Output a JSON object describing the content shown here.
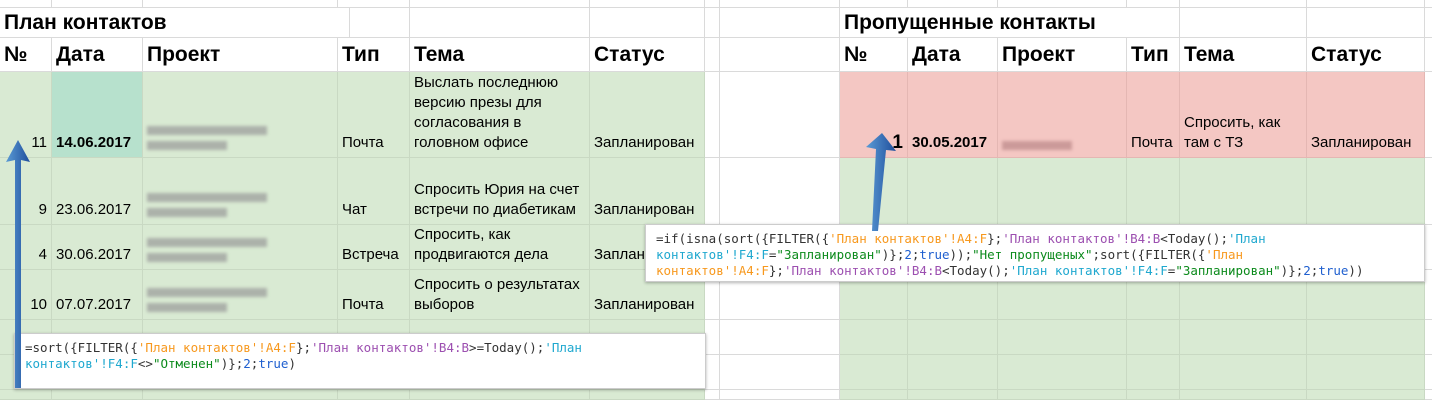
{
  "left": {
    "title": "План контактов",
    "headers": [
      "№",
      "Дата",
      "Проект",
      "Тип",
      "Тема",
      "Статус"
    ],
    "rows": [
      {
        "num": "11",
        "date": "14.06.2017",
        "type": "Почта",
        "topic": "Выслать последнюю версию презы для согласования в головном офисе",
        "status": "Запланирован"
      },
      {
        "num": "9",
        "date": "23.06.2017",
        "type": "Чат",
        "topic": "Спросить Юрия на счет встречи по диабетикам",
        "status": "Запланирован"
      },
      {
        "num": "4",
        "date": "30.06.2017",
        "type": "Встреча",
        "topic": "Спросить, как продвигаются дела",
        "status": "Заплан"
      },
      {
        "num": "10",
        "date": "07.07.2017",
        "type": "Почта",
        "topic": "Спросить о результатах выборов",
        "status": "Запланирован"
      }
    ]
  },
  "right": {
    "title": "Пропущенные контакты",
    "headers": [
      "№",
      "Дата",
      "Проект",
      "Тип",
      "Тема",
      "Статус"
    ],
    "rows": [
      {
        "num": "1",
        "date": "30.05.2017",
        "type": "Почта",
        "topic": "Спросить, как там с ТЗ",
        "status": "Запланирован"
      }
    ]
  },
  "formula_left": [
    {
      "t": "=sort({FILTER({",
      "c": "#333"
    },
    {
      "t": "'План контактов'!A4:F",
      "c": "#f7981d"
    },
    {
      "t": "};",
      "c": "#333"
    },
    {
      "t": "'План контактов'!B4:B",
      "c": "#9c4fb0"
    },
    {
      "t": ">=Today();",
      "c": "#333"
    },
    {
      "t": "'План\nконтактов'!F4:F",
      "c": "#1fa8cf"
    },
    {
      "t": "<>",
      "c": "#333"
    },
    {
      "t": "\"Отменен\"",
      "c": "#0b8a1b"
    },
    {
      "t": ")};",
      "c": "#333"
    },
    {
      "t": "2",
      "c": "#1f5fcf"
    },
    {
      "t": ";",
      "c": "#333"
    },
    {
      "t": "true",
      "c": "#1f5fcf"
    },
    {
      "t": ")",
      "c": "#333"
    }
  ],
  "formula_right": [
    {
      "t": "=if(isna(sort({FILTER({",
      "c": "#333"
    },
    {
      "t": "'План контактов'!A4:F",
      "c": "#f7981d"
    },
    {
      "t": "};",
      "c": "#333"
    },
    {
      "t": "'План контактов'!B4:B",
      "c": "#9c4fb0"
    },
    {
      "t": "<Today();",
      "c": "#333"
    },
    {
      "t": "'План\nконтактов'!F4:F",
      "c": "#1fa8cf"
    },
    {
      "t": "=",
      "c": "#333"
    },
    {
      "t": "\"Запланирован\"",
      "c": "#0b8a1b"
    },
    {
      "t": ")};",
      "c": "#333"
    },
    {
      "t": "2",
      "c": "#1f5fcf"
    },
    {
      "t": ";",
      "c": "#333"
    },
    {
      "t": "true",
      "c": "#1f5fcf"
    },
    {
      "t": "));",
      "c": "#333"
    },
    {
      "t": "\"Нет пропущеных\"",
      "c": "#0b8a1b"
    },
    {
      "t": ";sort({FILTER({",
      "c": "#333"
    },
    {
      "t": "'План\nконтактов'!A4:F",
      "c": "#f7981d"
    },
    {
      "t": "};",
      "c": "#333"
    },
    {
      "t": "'План контактов'!B4:B",
      "c": "#9c4fb0"
    },
    {
      "t": "<Today();",
      "c": "#333"
    },
    {
      "t": "'План контактов'!F4:F",
      "c": "#1fa8cf"
    },
    {
      "t": "=",
      "c": "#333"
    },
    {
      "t": "\"Запланирован\"",
      "c": "#0b8a1b"
    },
    {
      "t": ")};",
      "c": "#333"
    },
    {
      "t": "2",
      "c": "#1f5fcf"
    },
    {
      "t": ";",
      "c": "#333"
    },
    {
      "t": "true",
      "c": "#1f5fcf"
    },
    {
      "t": "))",
      "c": "#333"
    }
  ]
}
